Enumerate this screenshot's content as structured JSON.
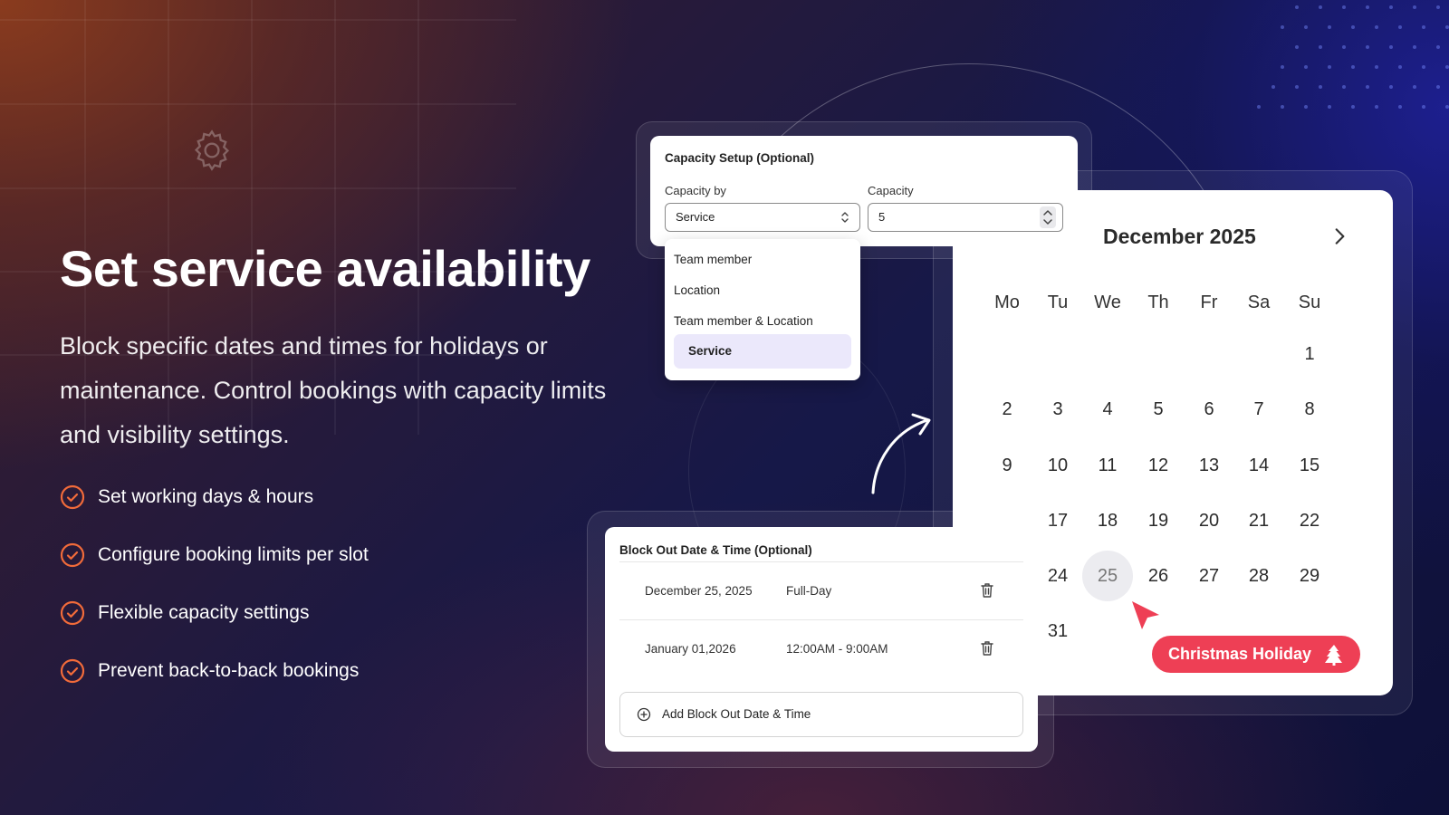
{
  "hero": {
    "title": "Set service availability",
    "description": "Block specific dates and times for holidays or maintenance. Control bookings with capacity limits and visibility settings.",
    "features": [
      "Set working days & hours",
      "Configure booking limits per slot",
      "Flexible capacity settings",
      "Prevent back-to-back bookings"
    ]
  },
  "colors": {
    "accent": "#ee3f55",
    "check": "#f26b3a",
    "selected_option": "#ebe8fb"
  },
  "capacity": {
    "title": "Capacity Setup (Optional)",
    "capacity_by_label": "Capacity by",
    "capacity_by_value": "Service",
    "capacity_label": "Capacity",
    "capacity_value": "5",
    "options": [
      "Team member",
      "Location",
      "Team member & Location",
      "Service"
    ],
    "selected_option": "Service"
  },
  "calendar": {
    "month": "December 2025",
    "weekdays": [
      "Mo",
      "Tu",
      "We",
      "Th",
      "Fr",
      "Sa",
      "Su"
    ],
    "days": [
      "1",
      "2",
      "3",
      "4",
      "5",
      "6",
      "7",
      "8",
      "9",
      "10",
      "11",
      "12",
      "13",
      "14",
      "15",
      "17",
      "18",
      "19",
      "20",
      "21",
      "22",
      "24",
      "25",
      "26",
      "27",
      "28",
      "29",
      "31"
    ],
    "selected_day": "25",
    "holiday_label": "Christmas Holiday"
  },
  "block_out": {
    "title": "Block Out Date & Time (Optional)",
    "rows": [
      {
        "date": "December 25, 2025",
        "time": "Full-Day"
      },
      {
        "date": "January 01,2026",
        "time": "12:00AM - 9:00AM"
      }
    ],
    "add_label": "Add Block Out Date & Time"
  }
}
